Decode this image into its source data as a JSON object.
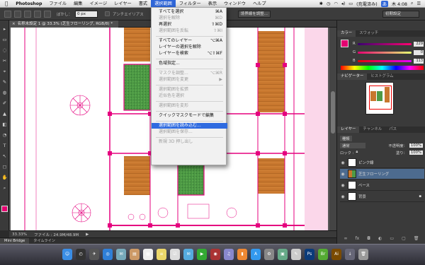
{
  "menubar": {
    "apple": "",
    "items": [
      "Photoshop",
      "ファイル",
      "編集",
      "イメージ",
      "レイヤー",
      "書式",
      "選択範囲",
      "フィルター",
      "表示",
      "ウィンドウ",
      "ヘルプ"
    ],
    "active_index": 6,
    "status": {
      "battery": "(充電済み)",
      "user_badge": "あ",
      "clock": "木 4:08"
    }
  },
  "options_bar": {
    "feather_label": "ぼかし：",
    "feather_value": "0 px",
    "antialias_label": "アンチエイリアス",
    "refine_edge": "境界線を調整...",
    "workspace": "初期設定",
    "window_title_fragment": "S6"
  },
  "document": {
    "tab_title": "名称未設定 1 @ 33.3% (芝生フローリング, RGB/8) *",
    "zoom": "33.33%",
    "file_info": "ファイル : 24.9M/48.9M"
  },
  "mini_bridge": {
    "tabs": [
      "Mini Bridge",
      "タイムライン"
    ]
  },
  "select_menu": {
    "items": [
      {
        "label": "すべてを選択",
        "shortcut": "⌘A",
        "disabled": false
      },
      {
        "label": "選択を解除",
        "shortcut": "⌘D",
        "disabled": true
      },
      {
        "label": "再選択",
        "shortcut": "⇧⌘D",
        "disabled": false
      },
      {
        "label": "選択範囲を反転",
        "shortcut": "⇧⌘I",
        "disabled": true
      },
      {
        "sep": true
      },
      {
        "label": "すべてのレイヤー",
        "shortcut": "⌥⌘A",
        "disabled": false
      },
      {
        "label": "レイヤーの選択を解除",
        "shortcut": "",
        "disabled": false
      },
      {
        "label": "レイヤーを検索",
        "shortcut": "⌥⇧⌘F",
        "disabled": false
      },
      {
        "sep": true
      },
      {
        "label": "色域指定...",
        "shortcut": "",
        "disabled": false
      },
      {
        "sep": true
      },
      {
        "label": "マスクを調整...",
        "shortcut": "⌥⌘R",
        "disabled": true
      },
      {
        "label": "選択範囲を変更",
        "shortcut": "▶",
        "disabled": true
      },
      {
        "sep": true
      },
      {
        "label": "選択範囲を拡張",
        "shortcut": "",
        "disabled": true
      },
      {
        "label": "近似色を選択",
        "shortcut": "",
        "disabled": true
      },
      {
        "sep": true
      },
      {
        "label": "選択範囲を変形",
        "shortcut": "",
        "disabled": true
      },
      {
        "sep": true
      },
      {
        "label": "クイックマスクモードで編集",
        "shortcut": "",
        "disabled": false
      },
      {
        "sep": true
      },
      {
        "label": "選択範囲を読み込む...",
        "shortcut": "",
        "disabled": false,
        "highlight": true
      },
      {
        "label": "選択範囲を保存...",
        "shortcut": "",
        "disabled": true
      },
      {
        "sep": true
      },
      {
        "label": "新規 3D 押し出し",
        "shortcut": "",
        "disabled": true
      }
    ]
  },
  "color_panel": {
    "tabs": [
      "カラー",
      "スウォッチ"
    ],
    "channels": [
      {
        "label": "R",
        "value": "229",
        "color": "#e0407a"
      },
      {
        "label": "G",
        "value": "0",
        "color": "#55c060"
      },
      {
        "label": "B",
        "value": "113",
        "color": "#4060d0"
      }
    ],
    "foreground": "#e50071"
  },
  "navigator_panel": {
    "tabs": [
      "ナビゲーター",
      "ヒストグラム"
    ]
  },
  "layers_panel": {
    "tabs": [
      "レイヤー",
      "チャンネル",
      "パス"
    ],
    "kind_label": "種類",
    "blend_mode": "通常",
    "opacity_label": "不透明度：",
    "opacity_value": "100%",
    "lock_label": "ロック :",
    "fill_label": "塗り：",
    "fill_value": "100%",
    "layers": [
      {
        "name": "ピンク線",
        "visible": true,
        "selected": false
      },
      {
        "name": "芝生フローリング",
        "visible": true,
        "selected": true
      },
      {
        "name": "ベース",
        "visible": true,
        "selected": false
      },
      {
        "name": "背景",
        "visible": true,
        "selected": false
      }
    ]
  },
  "colors": {
    "accent": "#2f6be0",
    "magenta": "#e5007f",
    "wood": "#c8772e",
    "grass": "#4e9a45"
  }
}
